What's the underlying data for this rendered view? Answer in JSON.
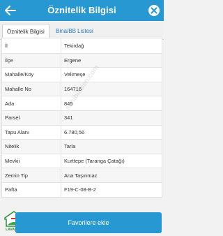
{
  "header": {
    "title": "Öznitelik Bilgisi"
  },
  "tabs": [
    {
      "label": "Öznitelik Bilgisi",
      "active": true
    },
    {
      "label": "Bina/BB Listesi",
      "active": false
    }
  ],
  "attributes": [
    {
      "key": "İl",
      "value": "Tekirdağ"
    },
    {
      "key": "İlçe",
      "value": "Ergene"
    },
    {
      "key": "Mahalle/Köy",
      "value": "Velimeşe"
    },
    {
      "key": "Mahalle No",
      "value": "164716"
    },
    {
      "key": "Ada",
      "value": "845"
    },
    {
      "key": "Parsel",
      "value": "341"
    },
    {
      "key": "Tapu Alanı",
      "value": "6.780,56"
    },
    {
      "key": "Nitelik",
      "value": "Tarla"
    },
    {
      "key": "Mevkii",
      "value": "Kurttepe (Taranga Çatağı)"
    },
    {
      "key": "Zemin Tip",
      "value": "Ana Taşınmaz"
    },
    {
      "key": "Pafta",
      "value": "F19-C-08-B-2"
    }
  ],
  "watermark": "sahibinden.com",
  "footer": {
    "favorite_label": "Favorilere ekle",
    "logo_text": "LAVANDA"
  },
  "colors": {
    "accent": "#2798d2",
    "tab_link": "#2a7ab8"
  }
}
